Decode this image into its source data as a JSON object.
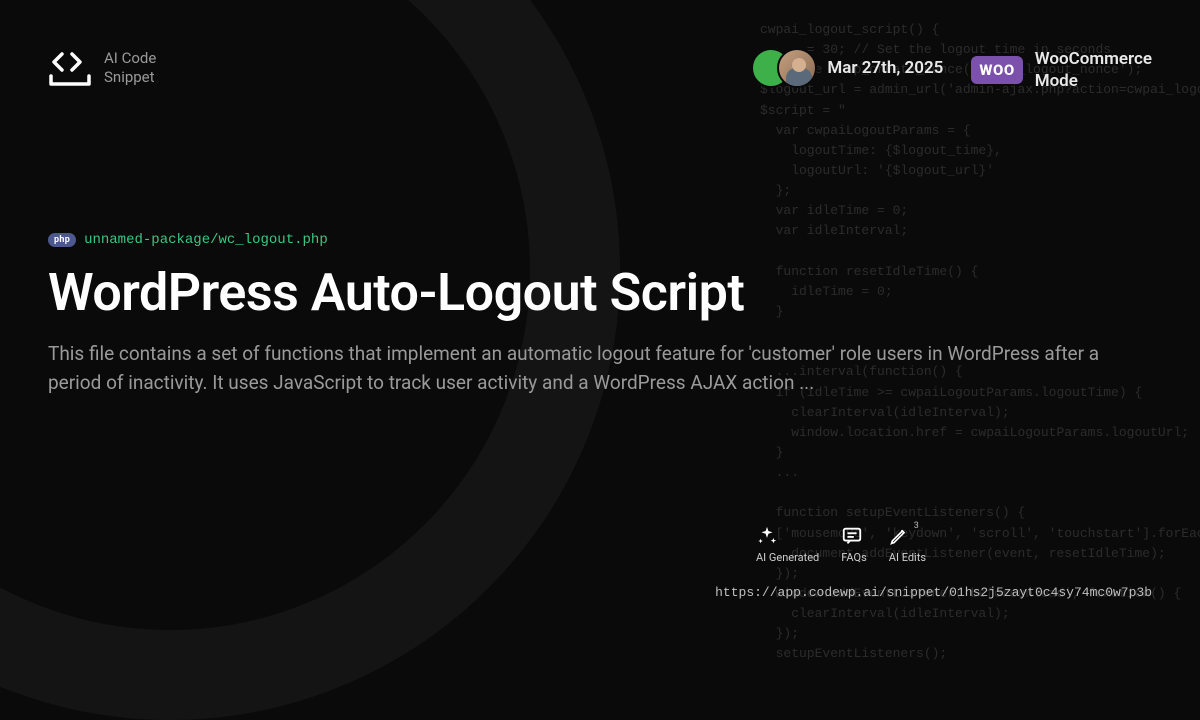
{
  "brand": {
    "line1": "AI Code",
    "line2": "Snippet"
  },
  "date": "Mar 27th, 2025",
  "mode": {
    "badge": "WOO",
    "line1": "WooCommerce",
    "line2": "Mode"
  },
  "file": {
    "lang": "php",
    "path": "unnamed-package/wc_logout.php"
  },
  "title": "WordPress Auto-Logout Script",
  "description": "This file contains a set of functions that implement an automatic logout feature for 'customer' role users in WordPress after a period of inactivity. It uses JavaScript to track user activity and a WordPress AJAX action ...",
  "tags": {
    "ai_generated": "AI Generated",
    "faqs": "FAQs",
    "ai_edits": {
      "label": "AI Edits",
      "count": "3"
    }
  },
  "url": "https://app.codewp.ai/snippet/01hs2j5zayt0c4sy74mc0w7p3b",
  "code_bg": "cwpai_logout_script() {\n  ... = 30; // Set the logout time in seconds\n  $nonce = wp_create_nonce('cwpai_logout_nonce');\n$logout_url = admin_url('admin-ajax.php?action=cwpai_logout&nonce=' . $logout_no\n$script = \"\n  var cwpaiLogoutParams = {\n    logoutTime: {$logout_time},\n    logoutUrl: '{$logout_url}'\n  };\n  var idleTime = 0;\n  var idleInterval;\n\n  function resetIdleTime() {\n    idleTime = 0;\n  }\n\n  ...\n  ...interval(function() {\n  if (idleTime >= cwpaiLogoutParams.logoutTime) {\n    clearInterval(idleInterval);\n    window.location.href = cwpaiLogoutParams.logoutUrl;\n  }\n  ...\n\n  function setupEventListeners() {\n  ['mousemove', 'keydown', 'scroll', 'touchstart'].forEach(function(event) {\n    document.addEventListener(event, resetIdleTime);\n  });\n  window.addEventListener('beforeunload', function() {\n    clearInterval(idleInterval);\n  });\n  setupEventListeners();"
}
